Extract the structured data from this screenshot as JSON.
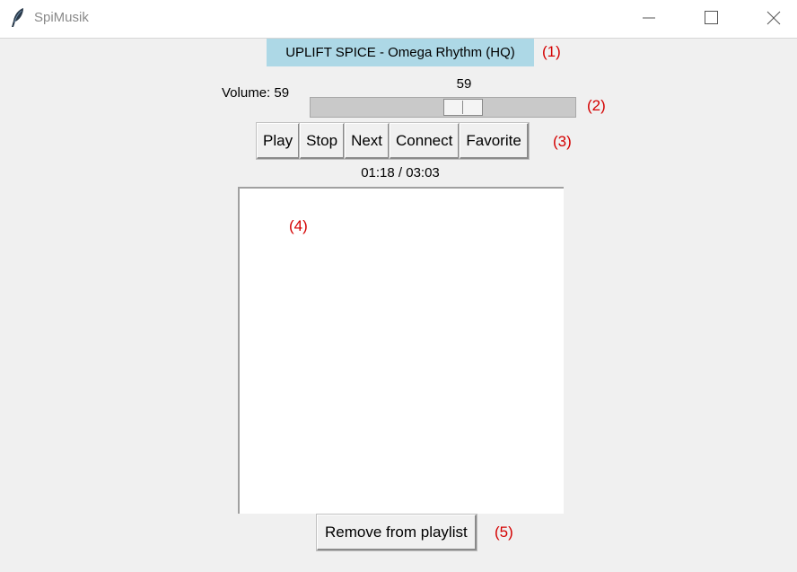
{
  "window": {
    "title": "SpiMusik",
    "icon": "feather-icon",
    "controls": [
      "minimize-icon",
      "maximize-icon",
      "close-icon"
    ]
  },
  "now_playing": {
    "title": "UPLIFT SPICE - Omega Rhythm (HQ)",
    "background": "#add8e6"
  },
  "volume": {
    "label": "Volume: 59",
    "value": 59,
    "value_text": "59",
    "min": 0,
    "max": 100
  },
  "buttons": {
    "play": "Play",
    "stop": "Stop",
    "next": "Next",
    "connect": "Connect",
    "favorite": "Favorite"
  },
  "time": "01:18 / 03:03",
  "playlist": {
    "items": []
  },
  "remove_button": "Remove from playlist",
  "annotations": {
    "a1": "(1)",
    "a2": "(2)",
    "a3": "(3)",
    "a4": "(4)",
    "a5": "(5)",
    "color": "#d40000"
  }
}
